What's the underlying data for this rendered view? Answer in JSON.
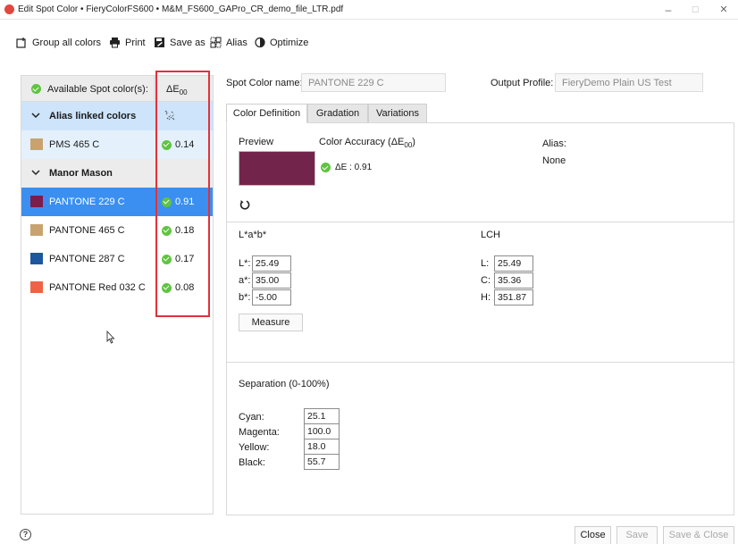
{
  "window": {
    "title": "Edit Spot Color • FieryColorFS600 • M&M_FS600_GAPro_CR_demo_file_LTR.pdf",
    "minimize_glyph": "–",
    "maximize_glyph": "☐",
    "close_glyph": "✕"
  },
  "toolbar": {
    "group_all_colors": "Group all colors",
    "print": "Print",
    "save_as": "Save as",
    "alias": "Alias",
    "optimize": "Optimize"
  },
  "left_panel": {
    "header_label": "Available Spot color(s):",
    "delta_e_header": "ΔE",
    "delta_e_header_sub": "00",
    "groups": [
      {
        "name": "Alias linked colors",
        "icon": "unlink-icon",
        "items": [
          {
            "name": "PMS 465 C",
            "swatch": "#c8a370",
            "delta_e": "0.14"
          }
        ]
      },
      {
        "name": "Manor Mason",
        "items": [
          {
            "name": "PANTONE 229 C",
            "swatch": "#7a1f45",
            "delta_e": "0.91",
            "selected": true
          },
          {
            "name": "PANTONE 465 C",
            "swatch": "#c8a370",
            "delta_e": "0.18"
          },
          {
            "name": "PANTONE 287 C",
            "swatch": "#1e56a0",
            "delta_e": "0.17"
          },
          {
            "name": "PANTONE Red 032 C",
            "swatch": "#f0614a",
            "delta_e": "0.08"
          }
        ]
      }
    ]
  },
  "spot_color_name": {
    "label": "Spot Color name:",
    "value": "PANTONE 229 C"
  },
  "output_profile": {
    "label": "Output Profile:",
    "value": "FieryDemo Plain US Test"
  },
  "tabs": [
    {
      "label": "Color Definition",
      "active": true
    },
    {
      "label": "Gradation",
      "active": false
    },
    {
      "label": "Variations",
      "active": false
    }
  ],
  "color_definition": {
    "preview_label": "Preview",
    "preview_color": "#73244a",
    "accuracy_label": "Color Accuracy (ΔE",
    "accuracy_label_sub": "00",
    "accuracy_label_end": ")",
    "accuracy_value": "ΔE : 0.91",
    "alias_label": "Alias:",
    "alias_value": "None"
  },
  "lab": {
    "title": "L*a*b*",
    "fields": [
      {
        "label": "L*:",
        "value": "25.49"
      },
      {
        "label": "a*:",
        "value": "35.00"
      },
      {
        "label": "b*:",
        "value": "-5.00"
      }
    ],
    "measure_button": "Measure"
  },
  "lch": {
    "title": "LCH",
    "fields": [
      {
        "label": "L:",
        "value": "25.49"
      },
      {
        "label": "C:",
        "value": "35.36"
      },
      {
        "label": "H:",
        "value": "351.87"
      }
    ]
  },
  "separation": {
    "title": "Separation (0-100%)",
    "fields": [
      {
        "label": "Cyan:",
        "value": "25.1"
      },
      {
        "label": "Magenta:",
        "value": "100.0"
      },
      {
        "label": "Yellow:",
        "value": "18.0"
      },
      {
        "label": "Black:",
        "value": "55.7"
      }
    ]
  },
  "footer": {
    "help_glyph": "?",
    "close": "Close",
    "save": "Save",
    "save_close": "Save & Close"
  },
  "colors": {
    "selection_blue": "#3b8ff0",
    "alias_group_bg": "#cde4fb",
    "alias_item_bg": "#e4f1fd",
    "group_bg": "#ececec",
    "check_green": "#5fc441",
    "highlight_red": "#e2313b"
  }
}
